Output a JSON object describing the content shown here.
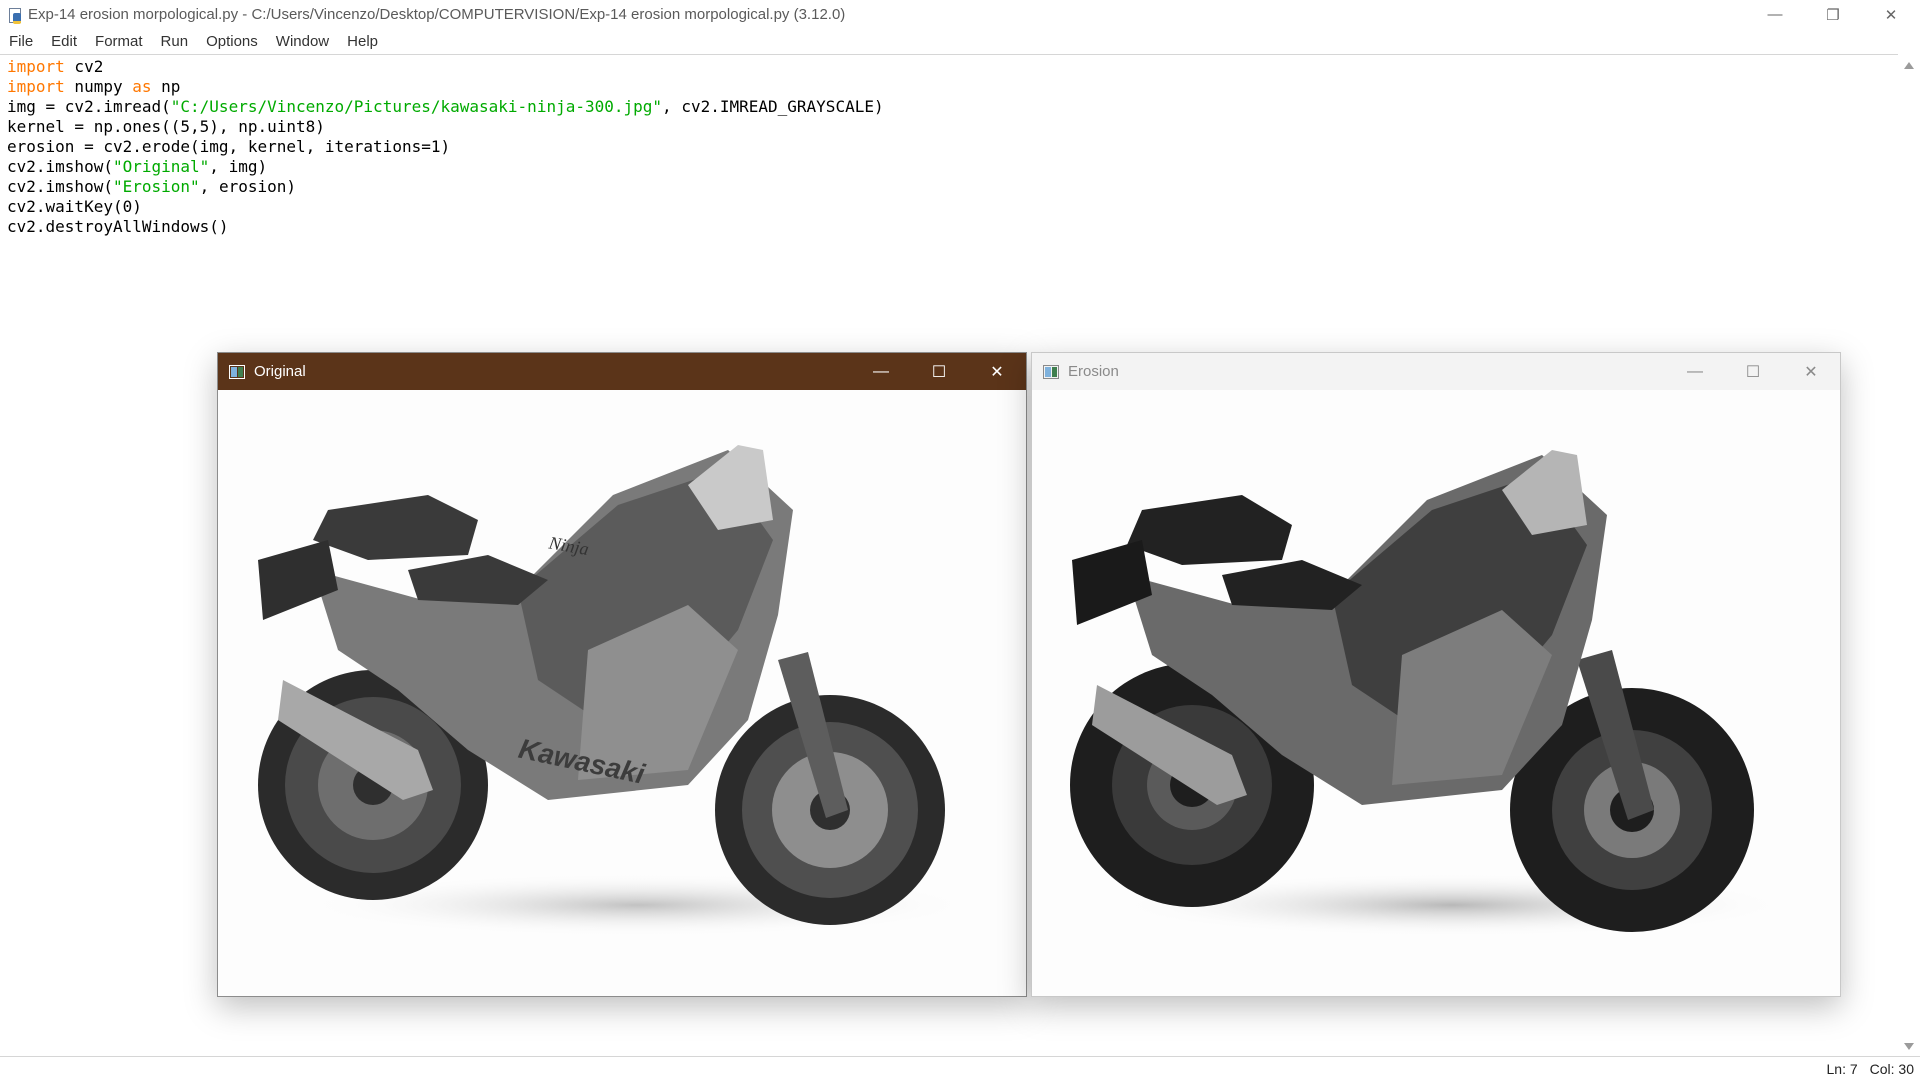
{
  "window": {
    "title": "Exp-14 erosion morpological.py - C:/Users/Vincenzo/Desktop/COMPUTERVISION/Exp-14 erosion morpological.py (3.12.0)",
    "icon": "python-file-icon"
  },
  "menu": {
    "items": [
      {
        "label": "File"
      },
      {
        "label": "Edit"
      },
      {
        "label": "Format"
      },
      {
        "label": "Run"
      },
      {
        "label": "Options"
      },
      {
        "label": "Window"
      },
      {
        "label": "Help"
      }
    ]
  },
  "code": {
    "lines": [
      [
        {
          "t": "import",
          "c": "kw"
        },
        {
          "t": " cv2"
        }
      ],
      [
        {
          "t": "import",
          "c": "kw"
        },
        {
          "t": " numpy "
        },
        {
          "t": "as",
          "c": "kw"
        },
        {
          "t": " np"
        }
      ],
      [
        {
          "t": "img = cv2.imread("
        },
        {
          "t": "\"C:/Users/Vincenzo/Pictures/kawasaki-ninja-300.jpg\"",
          "c": "str"
        },
        {
          "t": ", cv2.IMREAD_GRAYSCALE)"
        }
      ],
      [
        {
          "t": "kernel = np.ones((5,5), np.uint8)"
        }
      ],
      [
        {
          "t": "erosion = cv2.erode(img, kernel, iterations=1)"
        }
      ],
      [
        {
          "t": "cv2.imshow("
        },
        {
          "t": "\"Original\"",
          "c": "str"
        },
        {
          "t": ", img)"
        }
      ],
      [
        {
          "t": "cv2.imshow("
        },
        {
          "t": "\"Erosion\"",
          "c": "str"
        },
        {
          "t": ", erosion)"
        }
      ],
      [
        {
          "t": "cv2.waitKey(0)"
        }
      ],
      [
        {
          "t": "cv2.destroyAllWindows()"
        }
      ]
    ],
    "colors": {
      "keyword": "#ff7700",
      "string": "#00aa00"
    }
  },
  "status": {
    "line": "Ln: 7",
    "col": "Col: 30"
  },
  "windows": {
    "original": {
      "title": "Original",
      "state": "active",
      "title_color": "#5b3419"
    },
    "erosion": {
      "title": "Erosion",
      "state": "inactive"
    }
  }
}
